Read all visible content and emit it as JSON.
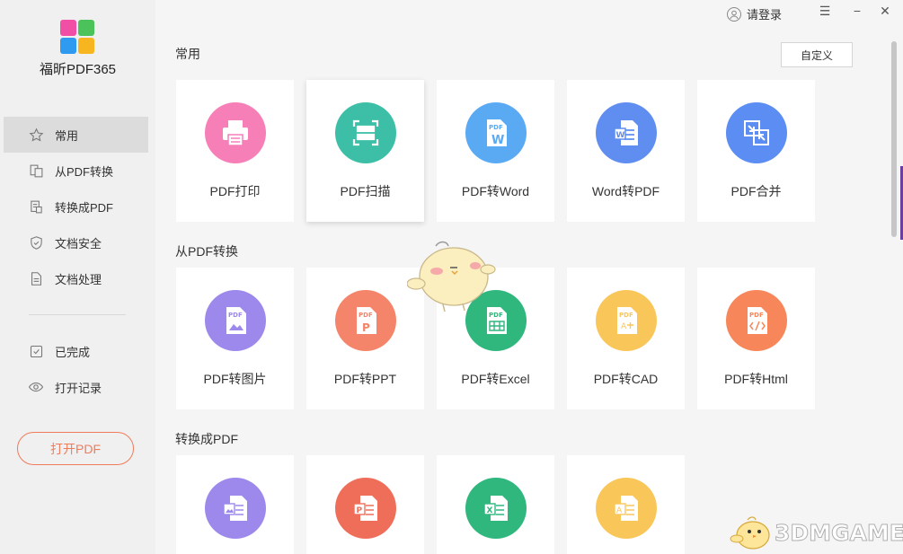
{
  "app": {
    "name": "福昕PDF365"
  },
  "topbar": {
    "login": "请登录",
    "menu_icon": "☰",
    "minimize_icon": "−",
    "close_icon": "✕"
  },
  "sidebar": {
    "items": [
      {
        "label": "常用",
        "icon": "star-icon"
      },
      {
        "label": "从PDF转换",
        "icon": "convert-from-pdf-icon"
      },
      {
        "label": "转换成PDF",
        "icon": "convert-to-pdf-icon"
      },
      {
        "label": "文档安全",
        "icon": "shield-icon"
      },
      {
        "label": "文档处理",
        "icon": "document-icon"
      },
      {
        "label": "已完成",
        "icon": "checkbox-icon"
      },
      {
        "label": "打开记录",
        "icon": "eye-icon"
      }
    ],
    "open_button": "打开PDF"
  },
  "sections": {
    "common": {
      "title": "常用",
      "custom_button": "自定义",
      "cards": [
        {
          "label": "PDF打印",
          "color": "#f77fb8",
          "icon": "printer-icon"
        },
        {
          "label": "PDF扫描",
          "color": "#3dbfa7",
          "icon": "scan-icon"
        },
        {
          "label": "PDF转Word",
          "color": "#5aaaf3",
          "icon": "pdf-to-word-icon"
        },
        {
          "label": "Word转PDF",
          "color": "#5f8ef0",
          "icon": "word-to-pdf-icon"
        },
        {
          "label": "PDF合并",
          "color": "#5b8df2",
          "icon": "merge-icon"
        }
      ]
    },
    "from_pdf": {
      "title": "从PDF转换",
      "cards": [
        {
          "label": "PDF转图片",
          "color": "#9d88ec",
          "icon": "pdf-to-image-icon"
        },
        {
          "label": "PDF转PPT",
          "color": "#f4856a",
          "icon": "pdf-to-ppt-icon"
        },
        {
          "label": "PDF转Excel",
          "color": "#2fb77e",
          "icon": "pdf-to-excel-icon"
        },
        {
          "label": "PDF转CAD",
          "color": "#f9c65a",
          "icon": "pdf-to-cad-icon"
        },
        {
          "label": "PDF转Html",
          "color": "#f7875a",
          "icon": "pdf-to-html-icon"
        }
      ]
    },
    "to_pdf": {
      "title": "转换成PDF",
      "cards": [
        {
          "label": "",
          "color": "#9d88ec",
          "icon": "image-to-pdf-icon"
        },
        {
          "label": "",
          "color": "#ef6e5a",
          "icon": "ppt-to-pdf-icon"
        },
        {
          "label": "",
          "color": "#2fb77e",
          "icon": "excel-to-pdf-icon"
        },
        {
          "label": "",
          "color": "#f9c65a",
          "icon": "cad-to-pdf-icon"
        }
      ]
    }
  },
  "watermark": {
    "text": "3DMGAME"
  }
}
